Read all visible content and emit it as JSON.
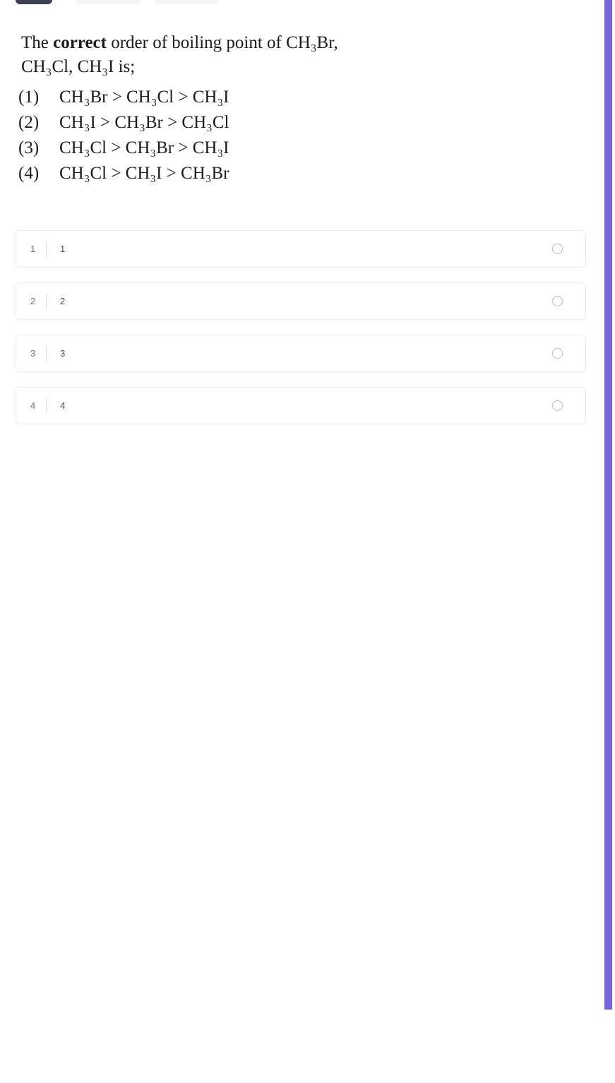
{
  "toolbar": {
    "items": [
      {
        "name": "primary-action-chip",
        "label": "",
        "color": "#3d3f56"
      },
      {
        "name": "secondary-chip-one",
        "label": "",
        "color": "#f4f4f6"
      },
      {
        "name": "secondary-chip-two",
        "label": "",
        "color": "#f4f4f6"
      }
    ]
  },
  "question": {
    "stem_line_one_pre": "The ",
    "stem_bold": "correct",
    "stem_line_one_post": " order of boiling point of CH₃Br,",
    "stem_line_two": "CH₃Cl, CH₃I is;",
    "options": [
      {
        "num": "(1)",
        "text": "CH₃Br > CH₃Cl > CH₃I"
      },
      {
        "num": "(2)",
        "text": "CH₃I > CH₃Br > CH₃Cl"
      },
      {
        "num": "(3)",
        "text": "CH₃Cl > CH₃Br > CH₃I"
      },
      {
        "num": "(4)",
        "text": "CH₃Cl > CH₃I > CH₃Br"
      }
    ]
  },
  "choices": [
    {
      "index": "1",
      "label": "1",
      "selected": false
    },
    {
      "index": "2",
      "label": "2",
      "selected": false
    },
    {
      "index": "3",
      "label": "3",
      "selected": false
    },
    {
      "index": "4",
      "label": "4",
      "selected": false
    }
  ],
  "scrollbar": {
    "thumb_color": "#7767dd",
    "track_color": "#ffffff"
  }
}
